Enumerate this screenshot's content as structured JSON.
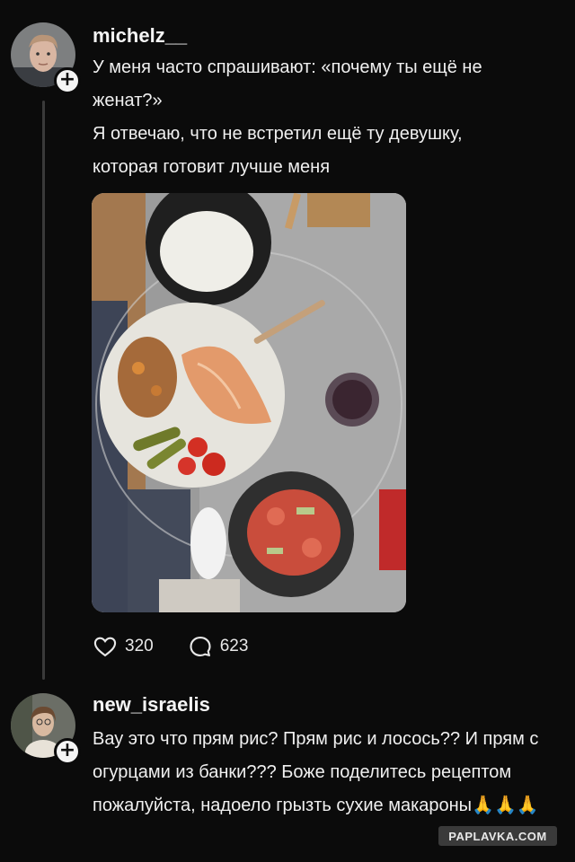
{
  "post": {
    "username": "michelz__",
    "paragraph1": "У меня часто спрашивают: «почему ты ещё не женат?»",
    "paragraph2": "Я отвечаю, что не встретил ещё ту девушку, которая готовит лучше меня",
    "likes": "320",
    "comments": "623"
  },
  "reply": {
    "username": "new_israelis",
    "text": "Вау это что прям рис? Прям рис и лосось?? И прям с огурцами из банки??? Боже поделитесь рецептом пожалуйста, надоело грызть сухие макароны🙏🙏🙏"
  },
  "icons": {
    "like": "heart-icon",
    "comment": "speech-bubble-icon",
    "follow": "plus-icon"
  },
  "watermark": "PAPLAVKA.COM",
  "colors": {
    "background": "#0b0b0b",
    "text": "#f0f0f0",
    "thread_line": "#3a3a3a"
  }
}
